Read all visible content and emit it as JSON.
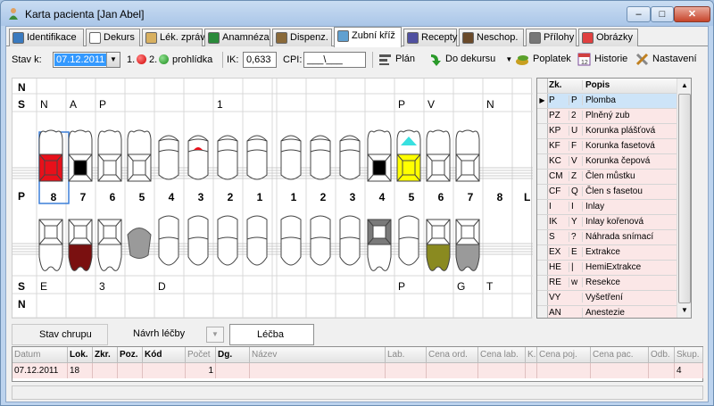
{
  "window": {
    "title": "Karta pacienta [Jan Abel]",
    "min_label": "–",
    "max_label": "□",
    "close_label": "✕"
  },
  "tabs": [
    {
      "label": "Identifikace",
      "ul": "I",
      "icon": "id-card-icon"
    },
    {
      "label": "Dekurs",
      "ul": "D",
      "icon": "page-icon"
    },
    {
      "label": "Lék. zprávy",
      "ul": "L",
      "icon": "report-icon"
    },
    {
      "label": "Anamnéza",
      "ul": "A",
      "icon": "anamnesis-icon"
    },
    {
      "label": "Dispenz.",
      "ul": "s",
      "icon": "people-icon"
    },
    {
      "label": "Zubní kříž",
      "ul": "",
      "icon": "tooth-icon"
    },
    {
      "label": "Recepty",
      "ul": "R",
      "icon": "prescription-icon"
    },
    {
      "label": "Neschop.",
      "ul": "N",
      "icon": "person-icon"
    },
    {
      "label": "Přílohy",
      "ul": "P",
      "icon": "paperclip-icon"
    },
    {
      "label": "Obrázky",
      "ul": "O",
      "icon": "rainbow-icon"
    }
  ],
  "toolbar": {
    "stav_label": "Stav k:",
    "date": "07.12.2011",
    "visit1": "1.",
    "visit2": "2.",
    "prohlidka": "prohlídka",
    "ik_label": "IK:",
    "ik_value": "0,633",
    "cpi_label": "CPI:",
    "cpi_value": "___\\___",
    "plan": "Plán",
    "do_dekursu": "Do dekursu",
    "poplatek": "Poplatek",
    "historie": "Historie",
    "nastaveni": "Nastavení"
  },
  "chart": {
    "left_labels": [
      "N",
      "S",
      "P",
      "S",
      "N"
    ],
    "right_label": "L",
    "top_row": [
      "N",
      "A",
      "P",
      "",
      "",
      "",
      "1",
      "",
      "",
      "",
      "",
      "",
      "P",
      "V",
      "",
      "N"
    ],
    "numbers": [
      "8",
      "7",
      "6",
      "5",
      "4",
      "3",
      "2",
      "1",
      "1",
      "2",
      "3",
      "4",
      "5",
      "6",
      "7",
      "8"
    ],
    "bottom_row": [
      "E",
      "",
      "3",
      "",
      "D",
      "",
      "",
      "",
      "",
      "",
      "",
      "",
      "P",
      "",
      "G",
      "T"
    ],
    "colors": {
      "red": "#e8101a",
      "yellow": "#ffff00",
      "cyan": "#38e0e0",
      "dark": "#7a1010",
      "olive": "#8a8a20",
      "gray": "#9a9a9a"
    }
  },
  "legend": {
    "headers": {
      "zk": "Zk.",
      "popis": "Popis"
    },
    "rows": [
      {
        "zk": "P",
        "k": "P",
        "popis": "Plomba"
      },
      {
        "zk": "PZ",
        "k": "2",
        "popis": "Plněný zub"
      },
      {
        "zk": "KP",
        "k": "U",
        "popis": "Korunka plášťová"
      },
      {
        "zk": "KF",
        "k": "F",
        "popis": "Korunka fasetová"
      },
      {
        "zk": "KC",
        "k": "V",
        "popis": "Korunka čepová"
      },
      {
        "zk": "CM",
        "k": "Z",
        "popis": "Člen můstku"
      },
      {
        "zk": "CF",
        "k": "Q",
        "popis": "Člen s fasetou"
      },
      {
        "zk": "I",
        "k": "I",
        "popis": "Inlay"
      },
      {
        "zk": "IK",
        "k": "Y",
        "popis": "Inlay kořenová"
      },
      {
        "zk": "S",
        "k": "?",
        "popis": "Náhrada snímací"
      },
      {
        "zk": "EX",
        "k": "E",
        "popis": "Extrakce"
      },
      {
        "zk": "HE",
        "k": "|",
        "popis": "HemiExtrakce"
      },
      {
        "zk": "RE",
        "k": "w",
        "popis": "Resekce"
      },
      {
        "zk": "VY",
        "k": "",
        "popis": "Vyšetření"
      },
      {
        "zk": "AN",
        "k": "",
        "popis": "Anestezie"
      }
    ]
  },
  "bottom_tabs": {
    "stav": "Stav chrupu",
    "navrh": "Návrh léčby",
    "lecba": "Léčba"
  },
  "table": {
    "headers": [
      "Datum",
      "Lok.",
      "Zkr.",
      "Poz.",
      "Kód",
      "Počet",
      "Dg.",
      "Název",
      "Lab.",
      "Cena ord.",
      "Cena lab.",
      "K.",
      "Cena poj.",
      "Cena pac.",
      "Odb.",
      "Skup."
    ],
    "row": [
      "07.12.2011",
      "18",
      "",
      "",
      "",
      "1",
      "",
      "",
      "",
      "",
      "",
      "",
      "",
      "",
      "",
      "4"
    ]
  }
}
